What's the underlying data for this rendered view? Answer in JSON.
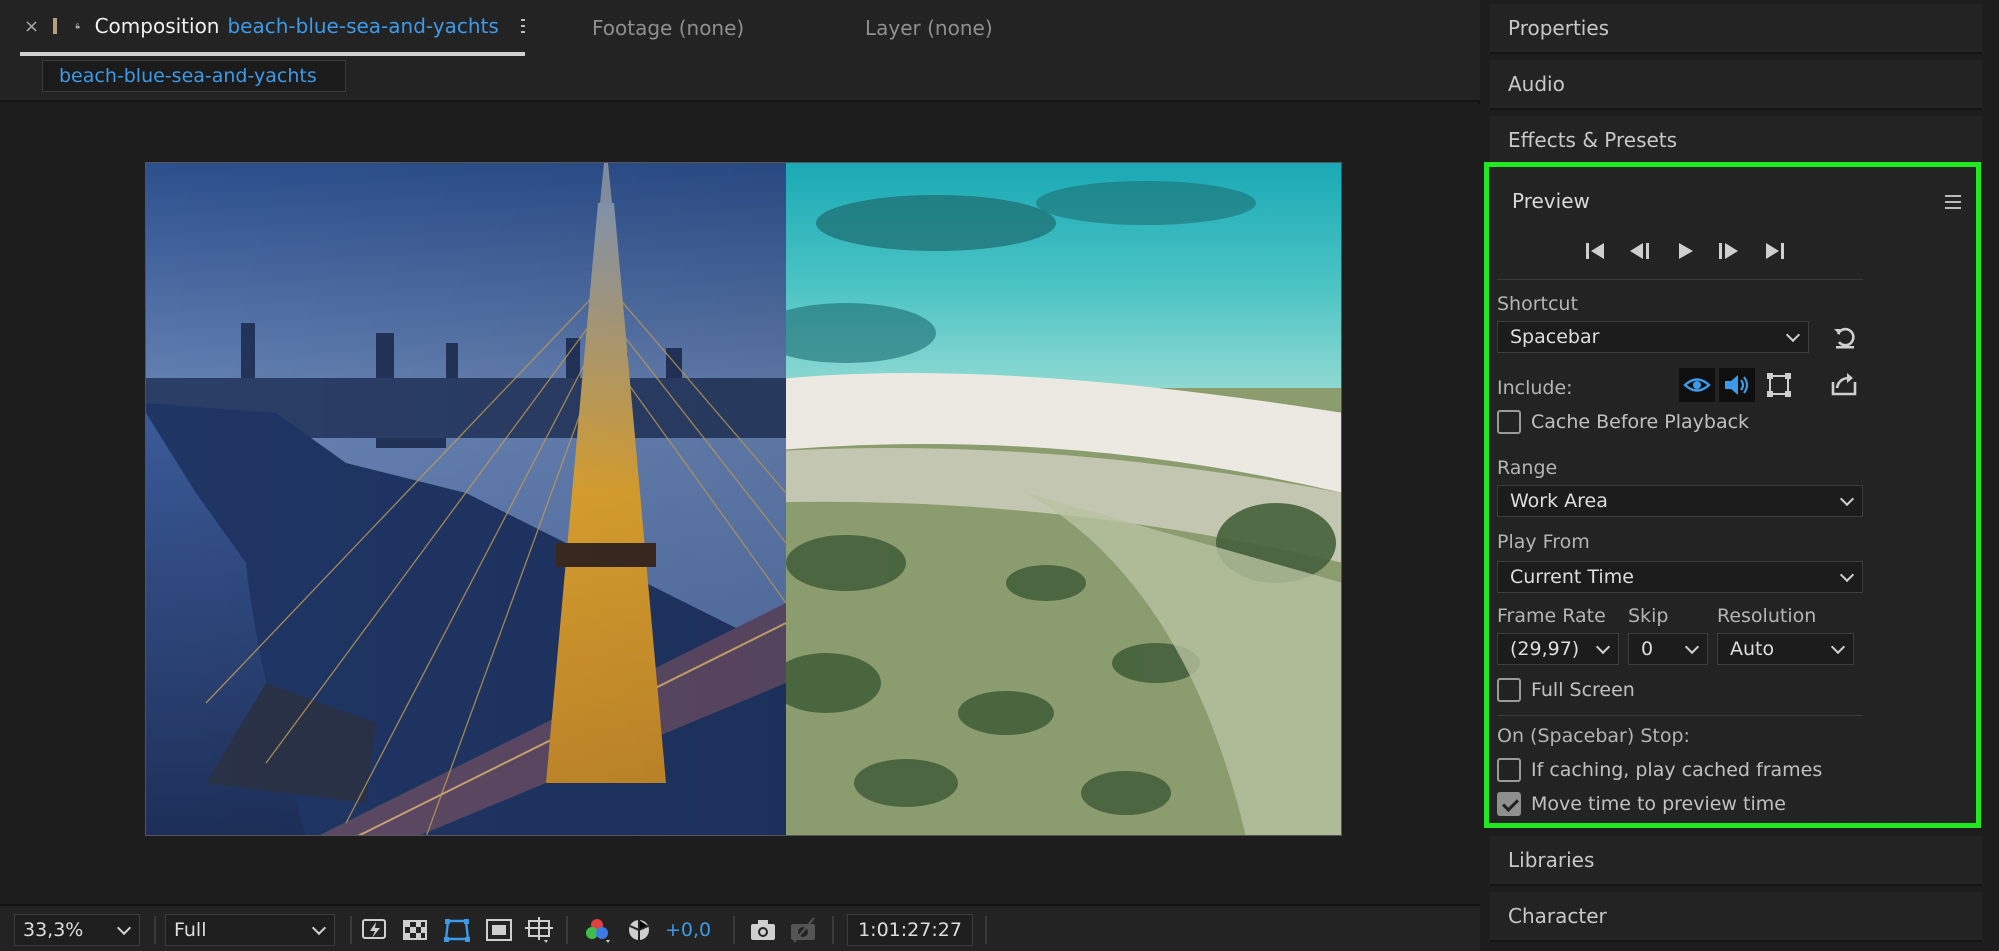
{
  "comp_panel": {
    "comp_tab": {
      "close": "×",
      "prefix": "Composition",
      "name": "beach-blue-sea-and-yachts"
    },
    "footage_tab": "Footage (none)",
    "layer_tab": "Layer (none)",
    "comp_chip": "beach-blue-sea-and-yachts"
  },
  "viewer_toolbar": {
    "magnification": "33,3%",
    "resolution": "Full",
    "exposure": "+0,0",
    "timecode": "1:01:27:27",
    "icons": [
      "fast-previews-icon",
      "transparency-grid-icon",
      "mask-visibility-icon",
      "region-of-interest-icon",
      "guides-grid-icon",
      "color-channel-icon",
      "reset-exposure-icon",
      "snapshot-icon",
      "show-snapshot-icon"
    ]
  },
  "right_panels": {
    "properties": "Properties",
    "audio": "Audio",
    "effects_presets": "Effects & Presets",
    "libraries": "Libraries",
    "character": "Character"
  },
  "preview": {
    "title": "Preview",
    "shortcut_label": "Shortcut",
    "shortcut_value": "Spacebar",
    "include_label": "Include:",
    "cache_before_playback": "Cache Before Playback",
    "range_label": "Range",
    "range_value": "Work Area",
    "play_from_label": "Play From",
    "play_from_value": "Current Time",
    "frame_rate_label": "Frame Rate",
    "frame_rate_value": "(29,97)",
    "skip_label": "Skip",
    "skip_value": "0",
    "resolution_label": "Resolution",
    "resolution_value": "Auto",
    "full_screen": "Full Screen",
    "stop_label": "On (Spacebar) Stop:",
    "if_caching": "If caching, play cached frames",
    "move_time": "Move time to preview time",
    "checkboxes": {
      "cache_before_playback": false,
      "full_screen": false,
      "if_caching": false,
      "move_time": true
    },
    "include": {
      "video": true,
      "audio": true,
      "overlays": false
    }
  },
  "colors": {
    "accent": "#3d9ae8",
    "highlight": "#22e822",
    "panel": "#232323",
    "background": "#1d1d1d"
  }
}
